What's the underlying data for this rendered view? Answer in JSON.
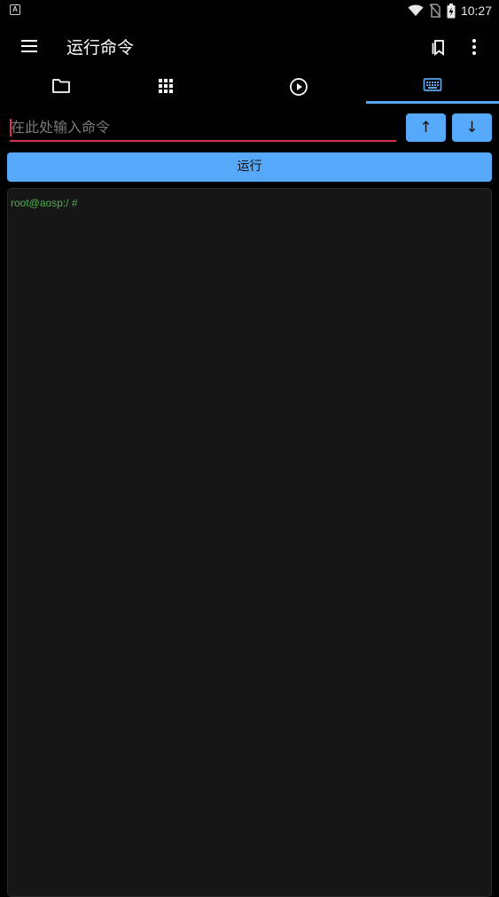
{
  "status_bar": {
    "notification_icon_label": "A",
    "time": "10:27",
    "icons": [
      "wifi-icon",
      "no-sim-icon",
      "battery-charging-icon"
    ]
  },
  "app_bar": {
    "title": "运行命令",
    "icons": [
      "menu-icon",
      "bookmark-icon",
      "more-vert-icon"
    ]
  },
  "tabs": [
    {
      "icon": "folder-icon",
      "selected": false
    },
    {
      "icon": "apps-grid-icon",
      "selected": false
    },
    {
      "icon": "play-circle-icon",
      "selected": false
    },
    {
      "icon": "keyboard-icon",
      "selected": true
    }
  ],
  "command": {
    "placeholder": "在此处输入命令",
    "value": "",
    "history_up_label": "↑",
    "history_down_label": "↓",
    "run_label": "运行"
  },
  "terminal": {
    "prompt": "root@aosp:/ #"
  },
  "colors": {
    "accent": "#55a8fa",
    "input_underline": "#d6314f",
    "prompt": "#4caf50",
    "background": "#000000",
    "terminal_bg": "#161616"
  }
}
